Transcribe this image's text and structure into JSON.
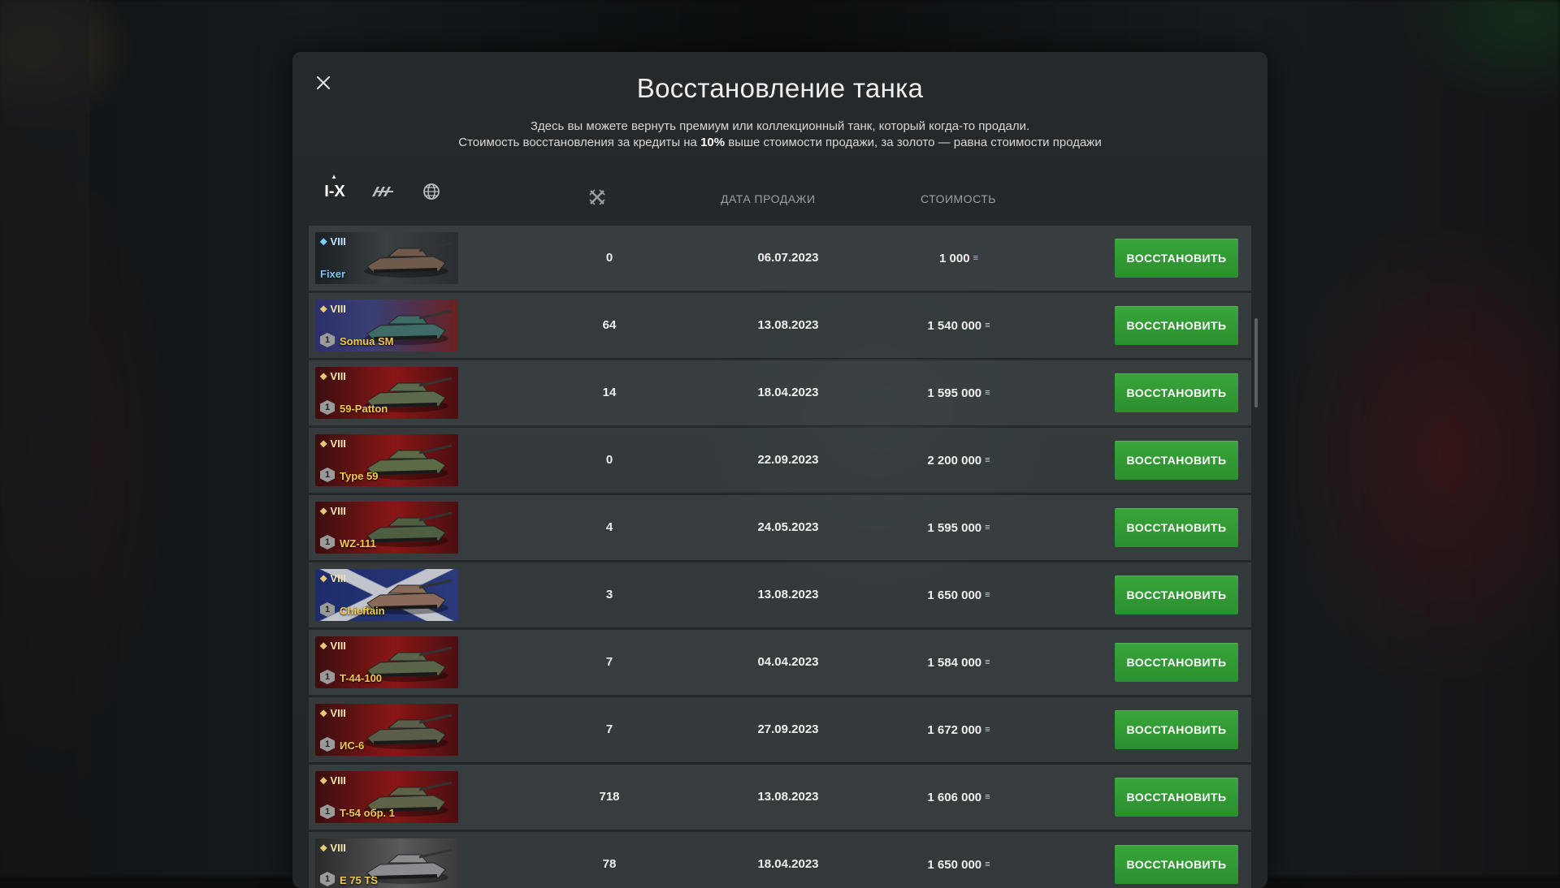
{
  "dialog": {
    "title": "Восстановление танка",
    "subtitle_line1": "Здесь вы можете вернуть премиум или коллекционный танк, который когда-то продали.",
    "subtitle_line2_pre": "Стоимость восстановления за кредиты на ",
    "subtitle_line2_bold": "10%",
    "subtitle_line2_post": " выше стоимости продажи, за золото — равна стоимости продажи"
  },
  "filters": {
    "tier_label": "I-X",
    "type_icon": "tank-class-icon",
    "nation_icon": "globe-icon",
    "battles_icon": "crossed-swords-icon"
  },
  "columns": {
    "date": "ДАТА ПРОДАЖИ",
    "cost": "СТОИМОСТЬ"
  },
  "restore_label": "ВОССТАНОВИТЬ",
  "colors": {
    "button_green": "#39a53b",
    "gold": "#f5b82e",
    "tank_name": "#f2c94c"
  },
  "tanks": [
    {
      "tier": "VIII",
      "name": "Fixer",
      "battles": "0",
      "date": "06.07.2023",
      "cost": "1 000",
      "currency": "gold",
      "currency_glyph": "≡",
      "badge": ""
    },
    {
      "tier": "VIII",
      "name": "Somua SM",
      "battles": "64",
      "date": "13.08.2023",
      "cost": "1 540 000",
      "currency": "silver",
      "currency_glyph": "≡",
      "badge": "1"
    },
    {
      "tier": "VIII",
      "name": "59-Patton",
      "battles": "14",
      "date": "18.04.2023",
      "cost": "1 595 000",
      "currency": "silver",
      "currency_glyph": "≡",
      "badge": "1"
    },
    {
      "tier": "VIII",
      "name": "Type 59",
      "battles": "0",
      "date": "22.09.2023",
      "cost": "2 200 000",
      "currency": "silver",
      "currency_glyph": "≡",
      "badge": "1"
    },
    {
      "tier": "VIII",
      "name": "WZ-111",
      "battles": "4",
      "date": "24.05.2023",
      "cost": "1 595 000",
      "currency": "silver",
      "currency_glyph": "≡",
      "badge": "1"
    },
    {
      "tier": "VIII",
      "name": "Chieftain",
      "battles": "3",
      "date": "13.08.2023",
      "cost": "1 650 000",
      "currency": "silver",
      "currency_glyph": "≡",
      "badge": "1"
    },
    {
      "tier": "VIII",
      "name": "T-44-100",
      "battles": "7",
      "date": "04.04.2023",
      "cost": "1 584 000",
      "currency": "silver",
      "currency_glyph": "≡",
      "badge": "1"
    },
    {
      "tier": "VIII",
      "name": "ИС-6",
      "battles": "7",
      "date": "27.09.2023",
      "cost": "1 672 000",
      "currency": "silver",
      "currency_glyph": "≡",
      "badge": "1"
    },
    {
      "tier": "VIII",
      "name": "T-54 обр. 1",
      "battles": "718",
      "date": "13.08.2023",
      "cost": "1 606 000",
      "currency": "silver",
      "currency_glyph": "≡",
      "badge": "1"
    },
    {
      "tier": "VIII",
      "name": "E 75 TS",
      "battles": "78",
      "date": "18.04.2023",
      "cost": "1 650 000",
      "currency": "silver",
      "currency_glyph": "≡",
      "badge": "1"
    }
  ]
}
